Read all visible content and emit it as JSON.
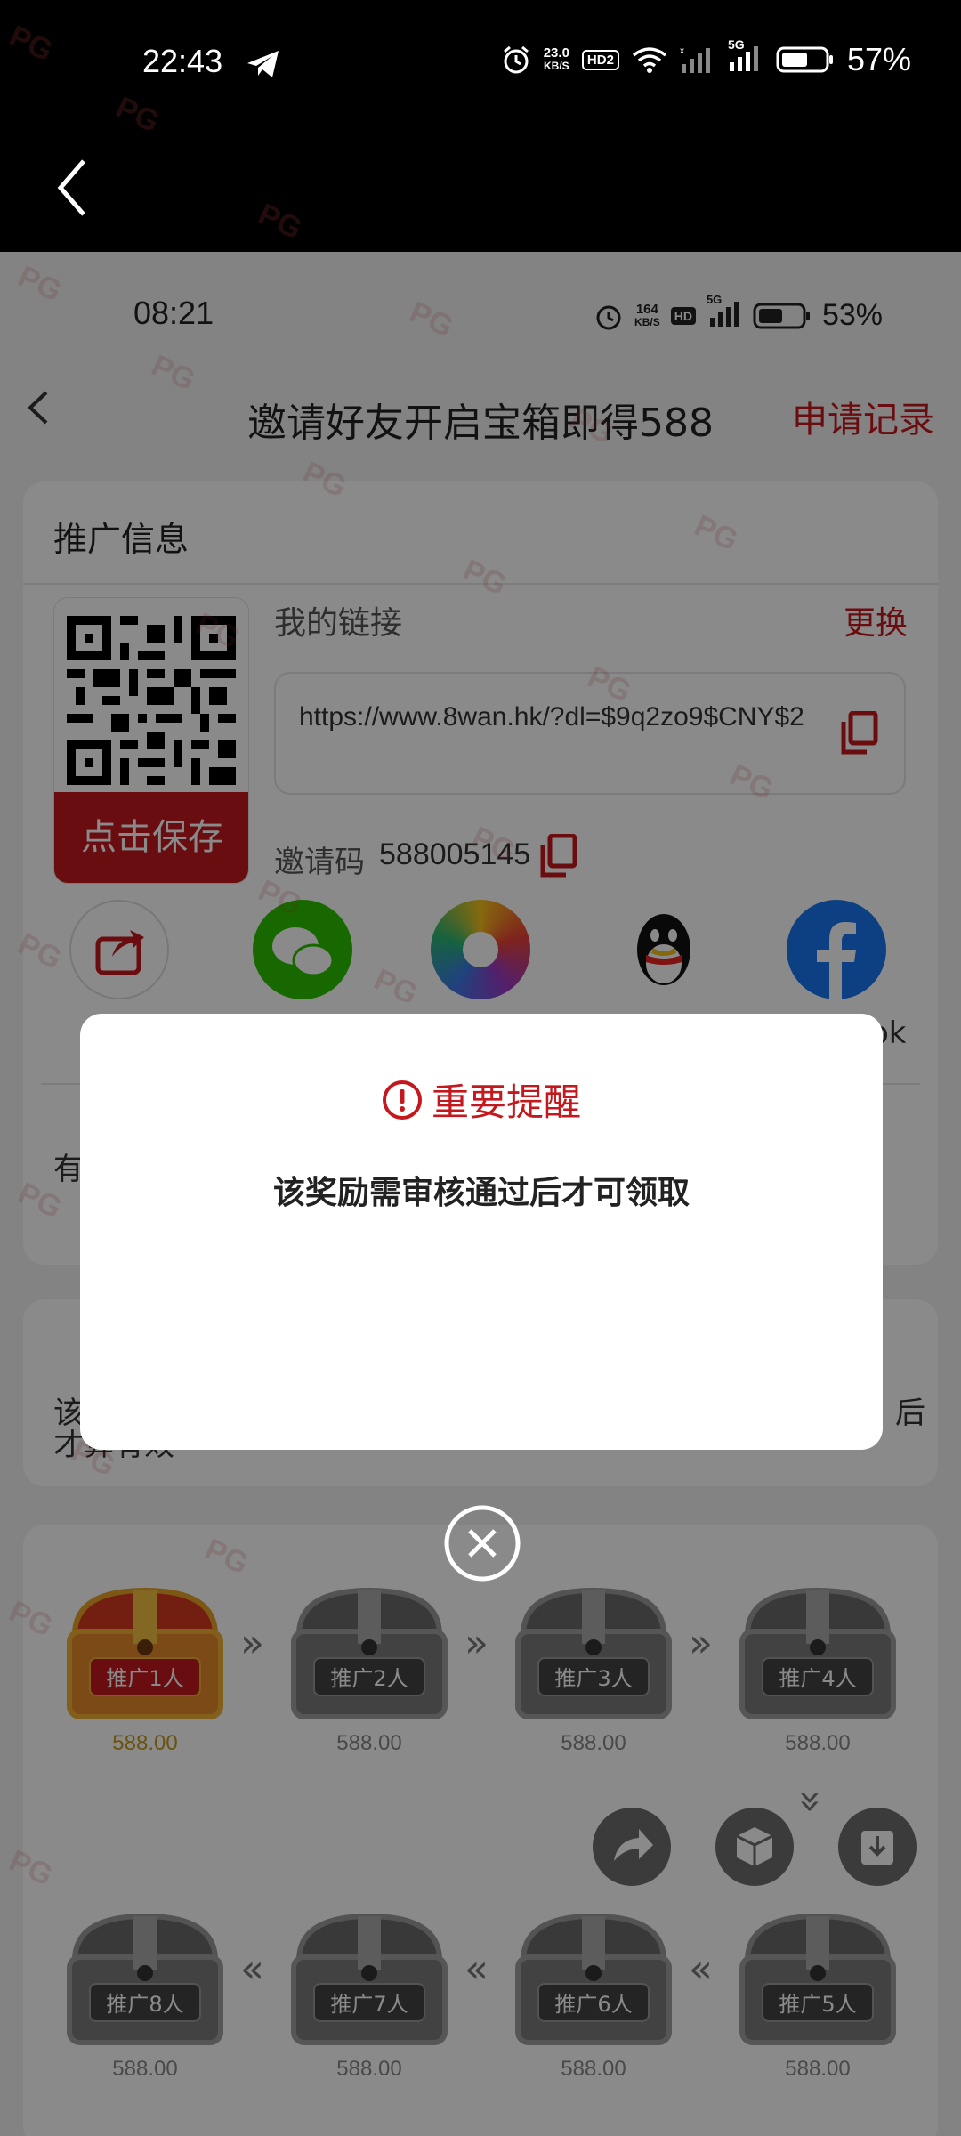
{
  "outer_status": {
    "time": "22:43",
    "net_speed_value": "23.0",
    "net_speed_unit": "KB/S",
    "hd_label": "HD2",
    "fiveg_label": "5G",
    "battery": "57%"
  },
  "inner_status": {
    "time": "08:21",
    "net_speed_value": "164",
    "net_speed_unit": "KB/S",
    "hd_label": "HD",
    "fiveg_label": "5G",
    "battery": "53%"
  },
  "header": {
    "title": "邀请好友开启宝箱即得588",
    "records_label": "申请记录"
  },
  "promo": {
    "section_title": "推广信息",
    "save_label": "点击保存",
    "my_link_label": "我的链接",
    "change_label": "更换",
    "link_url": "https://www.8wan.hk/?dl=$9q2zo9$CNY$2",
    "invite_label": "邀请码",
    "invite_code": "588005145",
    "share_labels": {
      "facebook_partial": "ok"
    }
  },
  "section2": {
    "text_partial": "有"
  },
  "section3": {
    "text_partial_1": "该",
    "text_partial_2": "才算有效",
    "text_partial_3": "后"
  },
  "chests": [
    {
      "label": "推广1人",
      "amount": "588.00",
      "unlocked": true
    },
    {
      "label": "推广2人",
      "amount": "588.00",
      "unlocked": false
    },
    {
      "label": "推广3人",
      "amount": "588.00",
      "unlocked": false
    },
    {
      "label": "推广4人",
      "amount": "588.00",
      "unlocked": false
    },
    {
      "label": "推广5人",
      "amount": "588.00",
      "unlocked": false
    },
    {
      "label": "推广6人",
      "amount": "588.00",
      "unlocked": false
    },
    {
      "label": "推广7人",
      "amount": "588.00",
      "unlocked": false
    },
    {
      "label": "推广8人",
      "amount": "588.00",
      "unlocked": false
    }
  ],
  "dialog": {
    "title": "重要提醒",
    "message": "该奖励需审核通过后才可领取"
  },
  "watermark": "PG",
  "colors": {
    "brand_red": "#c4181f",
    "gold": "#c49a1c"
  }
}
